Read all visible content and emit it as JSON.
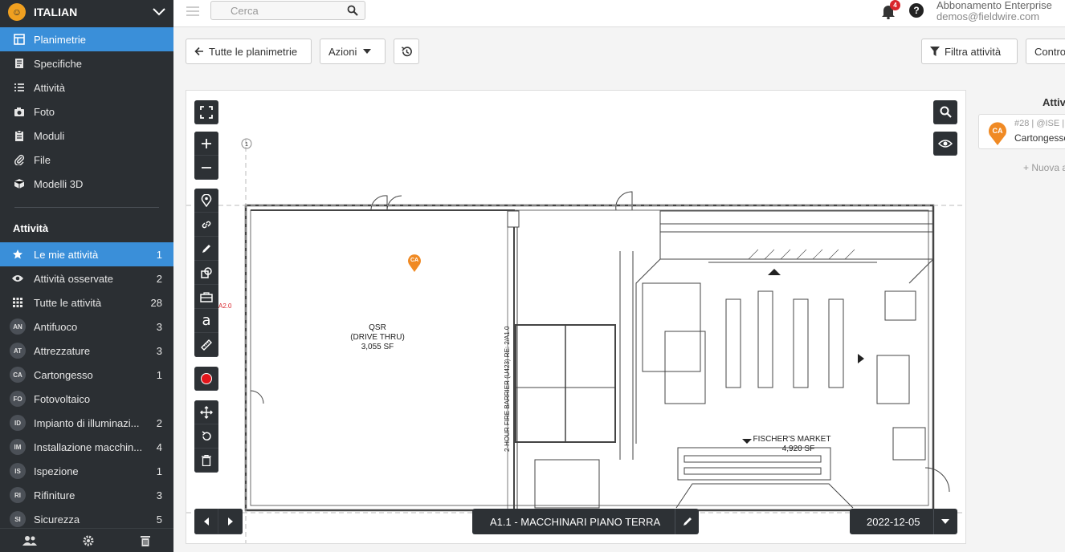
{
  "project": {
    "name": "ITALIAN"
  },
  "nav": [
    {
      "label": "Planimetrie",
      "icon": "plans-icon",
      "active": true
    },
    {
      "label": "Specifiche",
      "icon": "specs-icon"
    },
    {
      "label": "Attività",
      "icon": "list-icon"
    },
    {
      "label": "Foto",
      "icon": "camera-icon"
    },
    {
      "label": "Moduli",
      "icon": "clipboard-icon"
    },
    {
      "label": "File",
      "icon": "paperclip-icon"
    },
    {
      "label": "Modelli 3D",
      "icon": "cube-icon"
    }
  ],
  "tasks_section": {
    "title": "Attività",
    "items": [
      {
        "label": "Le mie attività",
        "count": "1",
        "icon": "star-icon",
        "active": true
      },
      {
        "label": "Attività osservate",
        "count": "2",
        "icon": "eye-icon"
      },
      {
        "label": "Tutte le attività",
        "count": "28",
        "icon": "grid-icon"
      },
      {
        "badge": "AN",
        "label": "Antifuoco",
        "count": "3"
      },
      {
        "badge": "AT",
        "label": "Attrezzature",
        "count": "3"
      },
      {
        "badge": "CA",
        "label": "Cartongesso",
        "count": "1"
      },
      {
        "badge": "FO",
        "label": "Fotovoltaico",
        "count": ""
      },
      {
        "badge": "ID",
        "label": "Impianto di illuminazi...",
        "count": "2"
      },
      {
        "badge": "IM",
        "label": "Installazione macchin...",
        "count": "4"
      },
      {
        "badge": "IS",
        "label": "Ispezione",
        "count": "1"
      },
      {
        "badge": "RI",
        "label": "Rifiniture",
        "count": "3"
      },
      {
        "badge": "SI",
        "label": "Sicurezza",
        "count": "5"
      }
    ]
  },
  "topbar": {
    "search_placeholder": "Cerca",
    "notifications_count": "4",
    "help": "?",
    "plan": "Abbonamento Enterprise",
    "email": "demos@fieldwire.com"
  },
  "toolbar": {
    "back_label": "Tutte le planimetrie",
    "actions_label": "Azioni",
    "filter_label": "Filtra attività",
    "controls_label": "Contro"
  },
  "plan": {
    "name": "A1.1 - MACCHINARI PIANO TERRA",
    "date": "2022-12-05",
    "marker": "CA",
    "room_label_1": "QSR",
    "room_label_2": "(DRIVE THRU)",
    "room_area": "3,055 SF",
    "market_label": "FISCHER'S MARKET",
    "market_area": "4,920 SF",
    "wall_label": "2-HOUR FIRE BARRIER (U423) RE: 2/A1.0",
    "ref_tag": "A2.0"
  },
  "right_panel": {
    "title": "Attiv",
    "card_meta": "#28 | @ISE | A",
    "card_name": "Cartongesso",
    "card_badge": "CA",
    "new_label": "+ Nuova a"
  }
}
